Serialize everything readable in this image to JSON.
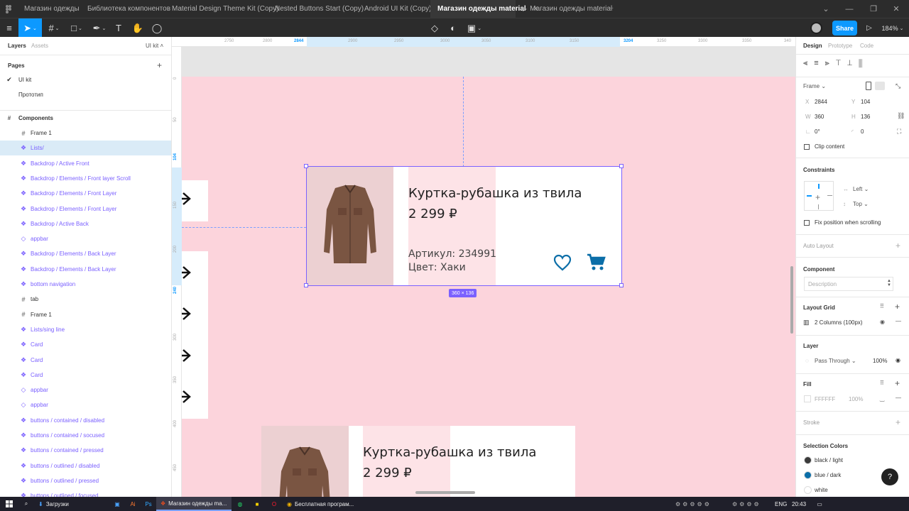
{
  "tabs": [
    {
      "label": "Магазин одежды"
    },
    {
      "label": "Библиотека компонентов"
    },
    {
      "label": "Material Design Theme Kit (Copy)"
    },
    {
      "label": "Nested Buttons Start (Copy)"
    },
    {
      "label": "Android UI Kit (Copy)"
    },
    {
      "label": "Магазин одежды material"
    },
    {
      "label": "Магазин одежды material"
    }
  ],
  "tab_close": "✕",
  "tab_add": "+",
  "toolbar": {
    "share_label": "Share",
    "zoom": "184%"
  },
  "left": {
    "layers_tab": "Layers",
    "assets_tab": "Assets",
    "file_tab": "UI kit",
    "pages_label": "Pages",
    "add": "+",
    "pages": [
      "UI kit",
      "Прототип"
    ],
    "components_label": "Components",
    "layers": [
      "Frame 1",
      "Lists/",
      "Backdrop / Active Front",
      "Backdrop / Elements / Front layer Scroll",
      "Backdrop / Elements / Front Layer",
      "Backdrop / Elements / Front Layer",
      "Backdrop / Active Back",
      "appbar",
      "Backdrop / Elements / Back Layer",
      "Backdrop / Elements / Back Layer",
      "bottom navigation",
      "tab",
      "Frame 1",
      "Lists/sing line",
      "Card",
      "Card",
      "Card",
      "appbar",
      "appbar",
      "buttons / contained / disabled",
      "buttons / contained / socused",
      "buttons / contained / pressed",
      "buttons / outlined / disabled",
      "buttons / outlined / pressed",
      "buttons / outlined / focused"
    ]
  },
  "ruler": {
    "top": [
      "2750",
      "2800",
      "2844",
      "2900",
      "2950",
      "3000",
      "3050",
      "3100",
      "3150",
      "3204",
      "3250",
      "3300",
      "3350",
      "340"
    ],
    "left": [
      "0",
      "50",
      "104",
      "150",
      "200",
      "240",
      "300",
      "350",
      "400",
      "450"
    ]
  },
  "canvas": {
    "card1": {
      "title": "Куртка-рубашка из твила",
      "price": "2 299 ₽",
      "sku": "Артикул: 234991",
      "color": "Цвет: Хаки"
    },
    "card2": {
      "title": "Куртка-рубашка из твила",
      "price": "2 299 ₽"
    },
    "size_badge": "360 × 136"
  },
  "right": {
    "tabs": [
      "Design",
      "Prototype",
      "Code"
    ],
    "frame_label": "Frame",
    "x_label": "X",
    "x": "2844",
    "y_label": "Y",
    "y": "104",
    "w_label": "W",
    "w": "360",
    "h_label": "H",
    "h": "136",
    "rotation": "0°",
    "radius": "0",
    "clip_content": "Clip content",
    "constraints": "Constraints",
    "c_left": "Left",
    "c_top": "Top",
    "fix_scroll": "Fix position when scrolling",
    "auto_layout": "Auto Layout",
    "component": "Component",
    "description_placeholder": "Description",
    "layout_grid": "Layout Grid",
    "grid_value": "2 Columns (100px)",
    "layer": "Layer",
    "blend": "Pass Through",
    "opacity": "100%",
    "fill": "Fill",
    "fill_hex": "FFFFFF",
    "fill_opacity": "100%",
    "stroke": "Stroke",
    "selection_colors": "Selection Colors",
    "colors": [
      {
        "name": "black / light",
        "hex": "#3a3a3a"
      },
      {
        "name": "blue / dark",
        "hex": "#0b6ea8"
      },
      {
        "name": "white",
        "hex": "#ffffff"
      }
    ],
    "help": "?"
  },
  "taskbar": {
    "downloads": "Загрузки",
    "figma": "Магазин одежды ma...",
    "chrome": "Бесплатная програм...",
    "lang": "ENG",
    "time": "20:43"
  },
  "colors": {
    "accent": "#0d99ff",
    "component": "#7b61ff",
    "canvas": "#fcd4dc",
    "icon_blue": "#0b6ea8"
  }
}
